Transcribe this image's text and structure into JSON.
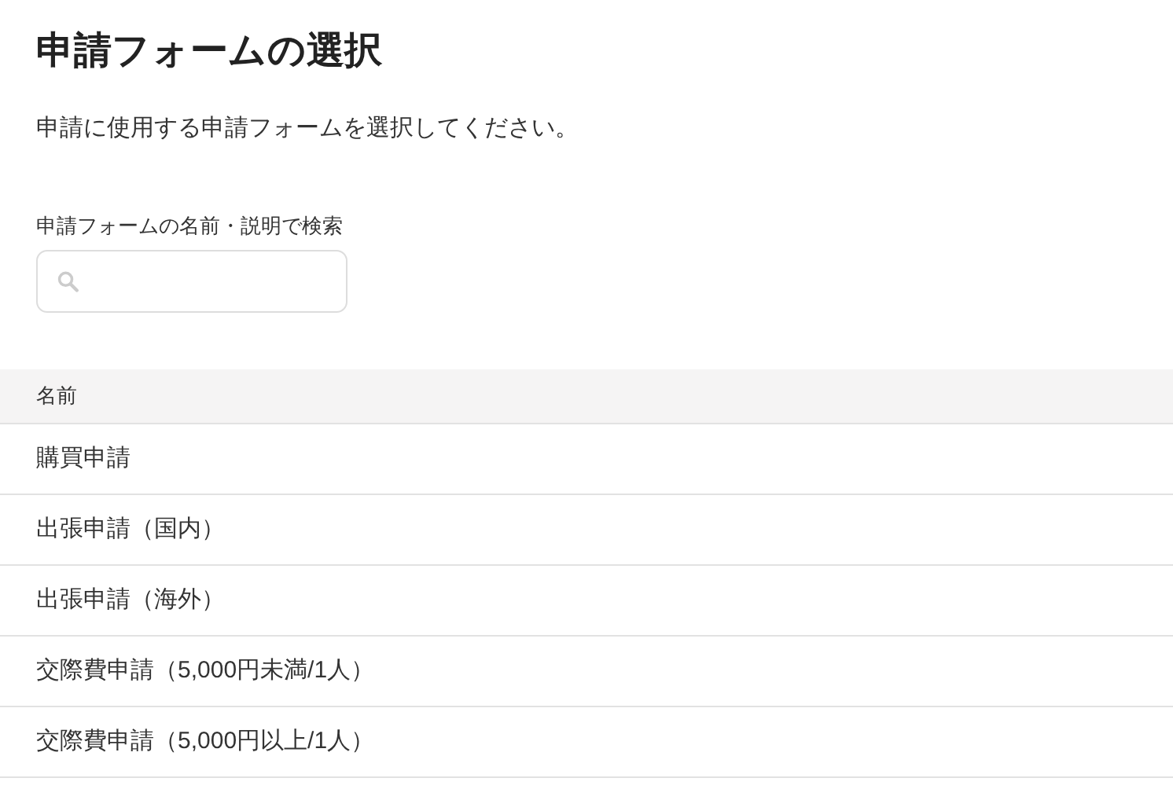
{
  "title": "申請フォームの選択",
  "description": "申請に使用する申請フォームを選択してください。",
  "search": {
    "label": "申請フォームの名前・説明で検索"
  },
  "table": {
    "columns": [
      "名前"
    ],
    "rows": [
      [
        "購買申請"
      ],
      [
        "出張申請（国内）"
      ],
      [
        "出張申請（海外）"
      ],
      [
        "交際費申請（5,000円未満/1人）"
      ],
      [
        "交際費申請（5,000円以上/1人）"
      ]
    ]
  }
}
